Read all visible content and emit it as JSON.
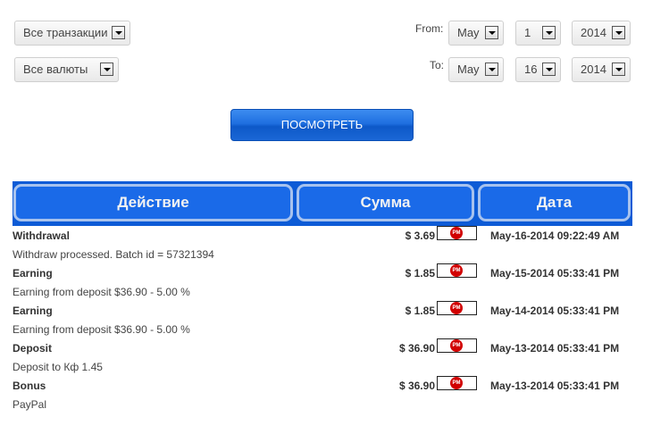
{
  "filters": {
    "transaction_type": "Все транзакции",
    "currency": "Все валюты",
    "from_label": "From:",
    "to_label": "To:",
    "from": {
      "month": "May",
      "day": "1",
      "year": "2014"
    },
    "to": {
      "month": "May",
      "day": "16",
      "year": "2014"
    }
  },
  "view_button": "ПОСМОТРЕТЬ",
  "table": {
    "headers": [
      "Действие",
      "Сумма",
      "Дата"
    ],
    "rows": [
      {
        "title": "Withdrawal",
        "amount": "$ 3.69",
        "badge": "PM",
        "date": "May-16-2014 09:22:49 AM",
        "description": "Withdraw processed. Batch id = 57321394"
      },
      {
        "title": "Earning",
        "amount": "$ 1.85",
        "badge": "PM",
        "date": "May-15-2014 05:33:41 PM",
        "description": "Earning from deposit $36.90 - 5.00 %"
      },
      {
        "title": "Earning",
        "amount": "$ 1.85",
        "badge": "PM",
        "date": "May-14-2014 05:33:41 PM",
        "description": "Earning from deposit $36.90 - 5.00 %"
      },
      {
        "title": "Deposit",
        "amount": "$ 36.90",
        "badge": "PM",
        "date": "May-13-2014 05:33:41 PM",
        "description": "Deposit to Кф 1.45"
      },
      {
        "title": "Bonus",
        "amount": "$ 36.90",
        "badge": "PM",
        "date": "May-13-2014 05:33:41 PM",
        "description": "PayPal"
      }
    ]
  },
  "colors": {
    "header_bg": "#0d5bd6",
    "header_cell": "#1a6ae8",
    "button": "#1f6fe0",
    "pm_badge": "#d10000"
  }
}
